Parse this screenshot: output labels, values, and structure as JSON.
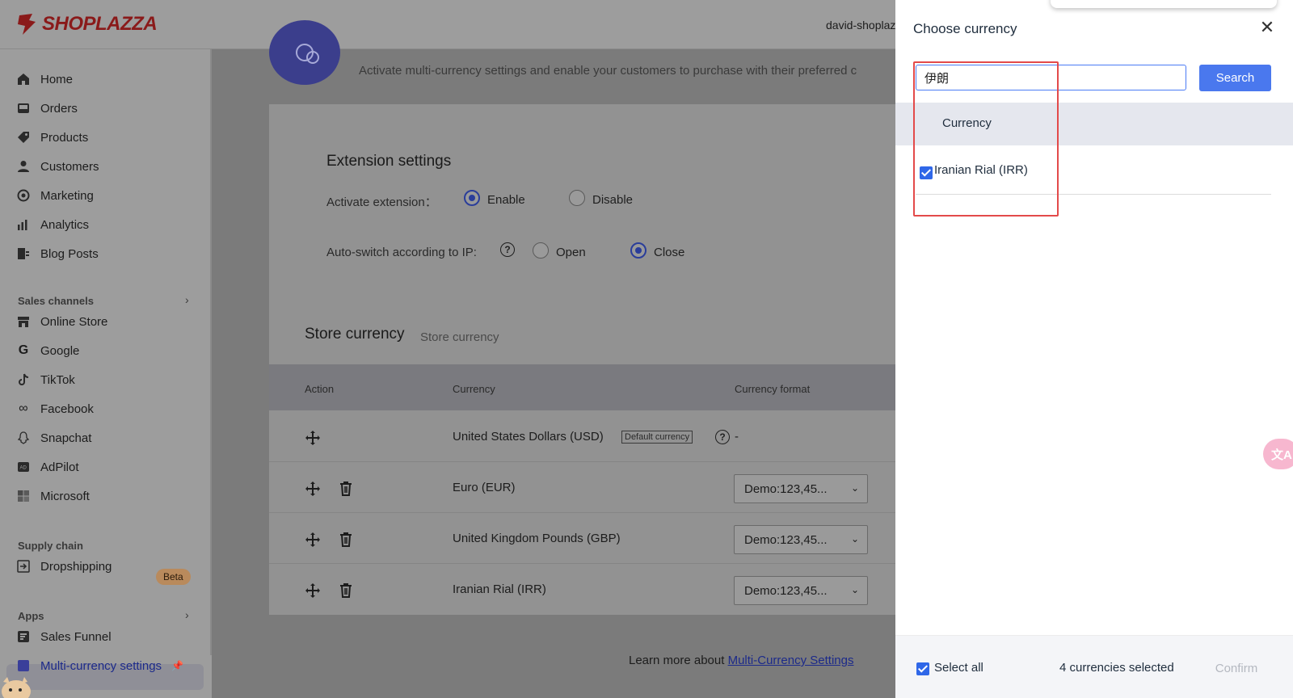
{
  "brand": {
    "name": "SHOPLAZZA",
    "color": "#8a1a1a"
  },
  "header": {
    "store_name": "david-shoplaz"
  },
  "sidebar": {
    "items": [
      {
        "label": "Home",
        "icon": "home-icon"
      },
      {
        "label": "Orders",
        "icon": "orders-icon"
      },
      {
        "label": "Products",
        "icon": "tag-icon"
      },
      {
        "label": "Customers",
        "icon": "person-icon"
      },
      {
        "label": "Marketing",
        "icon": "marketing-icon"
      },
      {
        "label": "Analytics",
        "icon": "bar-chart-icon"
      },
      {
        "label": "Blog Posts",
        "icon": "blog-icon"
      }
    ],
    "sales_channels": {
      "title": "Sales channels",
      "items": [
        {
          "label": "Online Store",
          "icon": "store-icon"
        },
        {
          "label": "Google",
          "icon": "google-icon"
        },
        {
          "label": "TikTok",
          "icon": "tiktok-icon"
        },
        {
          "label": "Facebook",
          "icon": "meta-icon"
        },
        {
          "label": "Snapchat",
          "icon": "snapchat-icon"
        },
        {
          "label": "AdPilot",
          "icon": "adpilot-icon"
        },
        {
          "label": "Microsoft",
          "icon": "microsoft-icon"
        }
      ]
    },
    "supply_chain": {
      "title": "Supply chain",
      "items": [
        {
          "label": "Dropshipping",
          "icon": "dropshipping-icon",
          "badge": "Beta"
        }
      ]
    },
    "apps": {
      "title": "Apps",
      "items": [
        {
          "label": "Sales Funnel",
          "icon": "funnel-icon"
        },
        {
          "label": "Multi-currency settings",
          "icon": "multicurrency-icon",
          "active": true
        }
      ]
    }
  },
  "page": {
    "intro": "Activate multi-currency settings and enable your customers to purchase with their preferred c",
    "extension": {
      "title": "Extension settings",
      "activate_label": "Activate extension：",
      "enable_label": "Enable",
      "disable_label": "Disable",
      "activate_value": "Enable",
      "autoswitch_label": "Auto-switch according to IP:",
      "open_label": "Open",
      "close_label": "Close",
      "autoswitch_value": "Close",
      "help_glyph": "?"
    },
    "store_currency": {
      "title": "Store currency",
      "subtitle": "Store currency",
      "columns": [
        "Action",
        "Currency",
        "Currency format"
      ],
      "rows": [
        {
          "currency": "United States Dollars (USD)",
          "tag": "Default currency",
          "format": "-"
        },
        {
          "currency": "Euro (EUR)",
          "format": "Demo:123,45..."
        },
        {
          "currency": "United Kingdom Pounds (GBP)",
          "format": "Demo:123,45..."
        },
        {
          "currency": "Iranian Rial (IRR)",
          "format": "Demo:123,45..."
        }
      ]
    },
    "learn_more": {
      "prefix": "Learn more about ",
      "link": "Multi-Currency Settings"
    }
  },
  "drawer": {
    "title": "Choose currency",
    "search": {
      "value": "伊朗",
      "button": "Search"
    },
    "list_header": "Currency",
    "results": [
      {
        "label": "Iranian Rial (IRR)",
        "checked": true
      }
    ],
    "footer": {
      "select_all": "Select all",
      "select_all_checked": true,
      "count_text": "4 currencies selected",
      "confirm": "Confirm"
    }
  },
  "colors": {
    "accent": "#4a78ee",
    "highlight": "#e34a4a",
    "checkbox": "#2f67e8"
  },
  "translate_fab": "文A"
}
